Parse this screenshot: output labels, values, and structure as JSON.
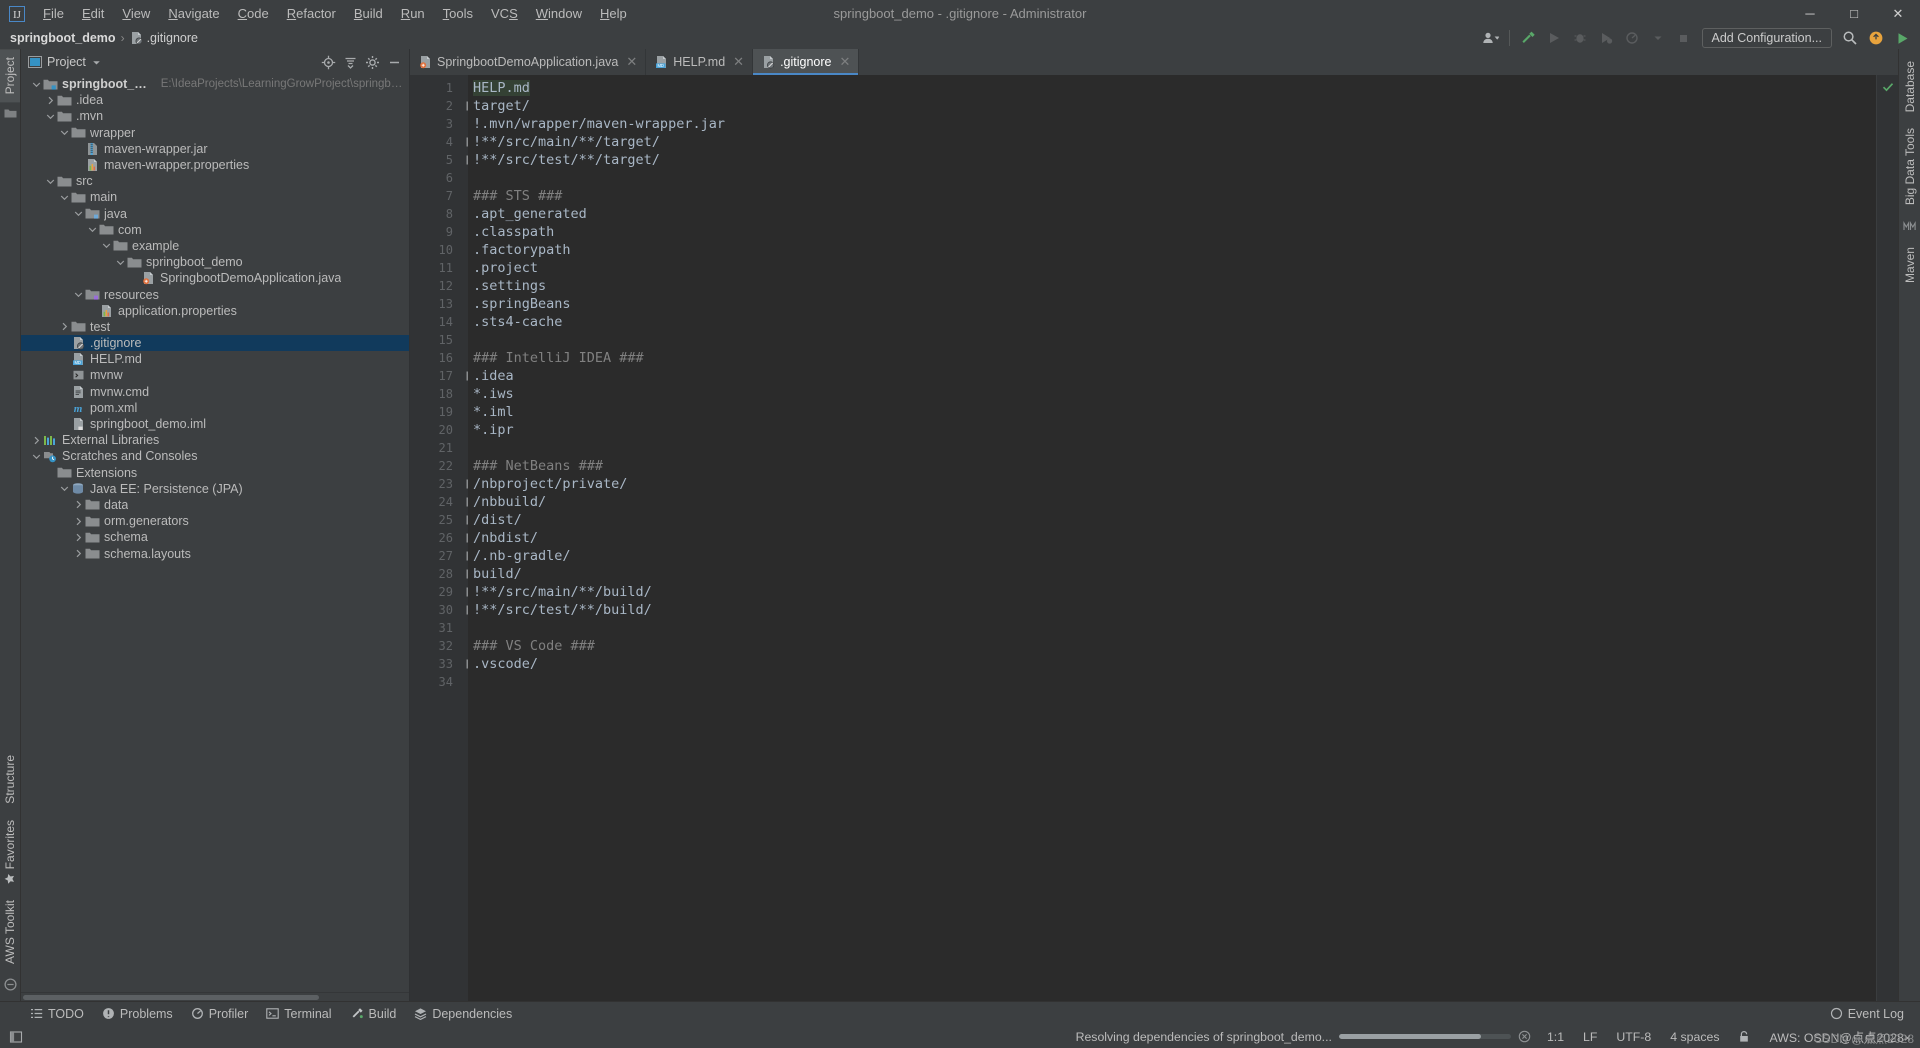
{
  "window": {
    "title": "springboot_demo - .gitignore - Administrator",
    "minimize": "─",
    "maximize": "□",
    "close": "✕"
  },
  "menubar": {
    "items": [
      {
        "label": "File",
        "mnemonic": "F"
      },
      {
        "label": "Edit",
        "mnemonic": "E"
      },
      {
        "label": "View",
        "mnemonic": "V"
      },
      {
        "label": "Navigate",
        "mnemonic": "N"
      },
      {
        "label": "Code",
        "mnemonic": "C"
      },
      {
        "label": "Refactor",
        "mnemonic": "R"
      },
      {
        "label": "Build",
        "mnemonic": "B"
      },
      {
        "label": "Run",
        "mnemonic": "R"
      },
      {
        "label": "Tools",
        "mnemonic": "T"
      },
      {
        "label": "VCS",
        "mnemonic": "S"
      },
      {
        "label": "Window",
        "mnemonic": "W"
      },
      {
        "label": "Help",
        "mnemonic": "H"
      }
    ]
  },
  "navbar": {
    "breadcrumb": [
      {
        "label": "springboot_demo",
        "bold": true
      },
      {
        "label": ".gitignore",
        "bold": false
      }
    ],
    "separator": "›",
    "add_configuration": "Add Configuration...",
    "icons": [
      "user-avatar-icon",
      "hammer-build-icon",
      "run-icon",
      "debug-icon",
      "run-coverage-icon",
      "profiler-icon",
      "stop-icon",
      "search-icon",
      "plugin-update-icon",
      "run-green-icon"
    ]
  },
  "left_rail": {
    "tabs": [
      "Project"
    ],
    "bottom_tabs": [
      "Structure",
      "Favorites",
      "AWS Toolkit"
    ]
  },
  "right_rail": {
    "tabs": [
      "Database",
      "Big Data Tools",
      "Maven"
    ]
  },
  "project_panel": {
    "title": "Project",
    "toolbar_icons": [
      "locate-target-icon",
      "collapse-all-icon",
      "settings-gear-icon",
      "hide-minus-icon"
    ],
    "tree": [
      {
        "depth": 0,
        "label": "springboot_demo",
        "path": "E:\\IdeaProjects\\LearningGrowProject\\springboot_demo",
        "arrow": "down",
        "icon": "module-folder-icon",
        "bold": true,
        "selected": false
      },
      {
        "depth": 1,
        "label": ".idea",
        "path": "",
        "arrow": "right",
        "icon": "folder-icon",
        "bold": false,
        "selected": false
      },
      {
        "depth": 1,
        "label": ".mvn",
        "path": "",
        "arrow": "down",
        "icon": "folder-icon",
        "bold": false,
        "selected": false
      },
      {
        "depth": 2,
        "label": "wrapper",
        "path": "",
        "arrow": "down",
        "icon": "folder-icon",
        "bold": false,
        "selected": false
      },
      {
        "depth": 3,
        "label": "maven-wrapper.jar",
        "path": "",
        "arrow": "none",
        "icon": "jar-file-icon",
        "bold": false,
        "selected": false
      },
      {
        "depth": 3,
        "label": "maven-wrapper.properties",
        "path": "",
        "arrow": "none",
        "icon": "properties-file-icon",
        "bold": false,
        "selected": false
      },
      {
        "depth": 1,
        "label": "src",
        "path": "",
        "arrow": "down",
        "icon": "folder-icon",
        "bold": false,
        "selected": false
      },
      {
        "depth": 2,
        "label": "main",
        "path": "",
        "arrow": "down",
        "icon": "folder-icon",
        "bold": false,
        "selected": false
      },
      {
        "depth": 3,
        "label": "java",
        "path": "",
        "arrow": "down",
        "icon": "source-folder-icon",
        "bold": false,
        "selected": false
      },
      {
        "depth": 4,
        "label": "com",
        "path": "",
        "arrow": "down",
        "icon": "package-folder-icon",
        "bold": false,
        "selected": false
      },
      {
        "depth": 5,
        "label": "example",
        "path": "",
        "arrow": "down",
        "icon": "package-folder-icon",
        "bold": false,
        "selected": false
      },
      {
        "depth": 6,
        "label": "springboot_demo",
        "path": "",
        "arrow": "down",
        "icon": "package-folder-icon",
        "bold": false,
        "selected": false
      },
      {
        "depth": 7,
        "label": "SpringbootDemoApplication.java",
        "path": "",
        "arrow": "none",
        "icon": "spring-class-icon",
        "bold": false,
        "selected": false
      },
      {
        "depth": 3,
        "label": "resources",
        "path": "",
        "arrow": "down",
        "icon": "resources-folder-icon",
        "bold": false,
        "selected": false
      },
      {
        "depth": 4,
        "label": "application.properties",
        "path": "",
        "arrow": "none",
        "icon": "properties-file-icon",
        "bold": false,
        "selected": false
      },
      {
        "depth": 2,
        "label": "test",
        "path": "",
        "arrow": "right",
        "icon": "folder-icon",
        "bold": false,
        "selected": false
      },
      {
        "depth": 2,
        "label": ".gitignore",
        "path": "",
        "arrow": "none",
        "icon": "gitignore-file-icon",
        "bold": false,
        "selected": true
      },
      {
        "depth": 2,
        "label": "HELP.md",
        "path": "",
        "arrow": "none",
        "icon": "markdown-file-icon",
        "bold": false,
        "selected": false
      },
      {
        "depth": 2,
        "label": "mvnw",
        "path": "",
        "arrow": "none",
        "icon": "shell-script-icon",
        "bold": false,
        "selected": false
      },
      {
        "depth": 2,
        "label": "mvnw.cmd",
        "path": "",
        "arrow": "none",
        "icon": "cmd-file-icon",
        "bold": false,
        "selected": false
      },
      {
        "depth": 2,
        "label": "pom.xml",
        "path": "",
        "arrow": "none",
        "icon": "maven-pom-icon",
        "bold": false,
        "selected": false
      },
      {
        "depth": 2,
        "label": "springboot_demo.iml",
        "path": "",
        "arrow": "none",
        "icon": "iml-file-icon",
        "bold": false,
        "selected": false
      },
      {
        "depth": 0,
        "label": "External Libraries",
        "path": "",
        "arrow": "right",
        "icon": "libraries-icon",
        "bold": false,
        "selected": false
      },
      {
        "depth": 0,
        "label": "Scratches and Consoles",
        "path": "",
        "arrow": "down",
        "icon": "scratches-icon",
        "bold": false,
        "selected": false
      },
      {
        "depth": 1,
        "label": "Extensions",
        "path": "",
        "arrow": "none",
        "icon": "folder-icon",
        "bold": false,
        "selected": false
      },
      {
        "depth": 2,
        "label": "Java EE: Persistence (JPA)",
        "path": "",
        "arrow": "down",
        "icon": "jpa-icon",
        "bold": false,
        "selected": false
      },
      {
        "depth": 3,
        "label": "data",
        "path": "",
        "arrow": "right",
        "icon": "folder-icon",
        "bold": false,
        "selected": false
      },
      {
        "depth": 3,
        "label": "orm.generators",
        "path": "",
        "arrow": "right",
        "icon": "folder-icon",
        "bold": false,
        "selected": false
      },
      {
        "depth": 3,
        "label": "schema",
        "path": "",
        "arrow": "right",
        "icon": "folder-icon",
        "bold": false,
        "selected": false
      },
      {
        "depth": 3,
        "label": "schema.layouts",
        "path": "",
        "arrow": "right",
        "icon": "folder-icon",
        "bold": false,
        "selected": false
      }
    ]
  },
  "editor": {
    "tabs": [
      {
        "label": "SpringbootDemoApplication.java",
        "icon": "spring-class-icon",
        "active": false,
        "close": "✕"
      },
      {
        "label": "HELP.md",
        "icon": "markdown-file-icon",
        "active": false,
        "close": "✕"
      },
      {
        "label": ".gitignore",
        "icon": "gitignore-file-icon",
        "active": true,
        "close": "✕"
      }
    ],
    "lines": [
      {
        "n": 1,
        "text": "HELP.md",
        "comment": false,
        "folder": false,
        "highlight": true
      },
      {
        "n": 2,
        "text": "target/",
        "comment": false,
        "folder": true,
        "highlight": false
      },
      {
        "n": 3,
        "text": "!.mvn/wrapper/maven-wrapper.jar",
        "comment": false,
        "folder": false,
        "highlight": false
      },
      {
        "n": 4,
        "text": "!**/src/main/**/target/",
        "comment": false,
        "folder": true,
        "highlight": false
      },
      {
        "n": 5,
        "text": "!**/src/test/**/target/",
        "comment": false,
        "folder": true,
        "highlight": false
      },
      {
        "n": 6,
        "text": "",
        "comment": false,
        "folder": false,
        "highlight": false
      },
      {
        "n": 7,
        "text": "### STS ###",
        "comment": true,
        "folder": false,
        "highlight": false
      },
      {
        "n": 8,
        "text": ".apt_generated",
        "comment": false,
        "folder": false,
        "highlight": false
      },
      {
        "n": 9,
        "text": ".classpath",
        "comment": false,
        "folder": false,
        "highlight": false
      },
      {
        "n": 10,
        "text": ".factorypath",
        "comment": false,
        "folder": false,
        "highlight": false
      },
      {
        "n": 11,
        "text": ".project",
        "comment": false,
        "folder": false,
        "highlight": false
      },
      {
        "n": 12,
        "text": ".settings",
        "comment": false,
        "folder": false,
        "highlight": false
      },
      {
        "n": 13,
        "text": ".springBeans",
        "comment": false,
        "folder": false,
        "highlight": false
      },
      {
        "n": 14,
        "text": ".sts4-cache",
        "comment": false,
        "folder": false,
        "highlight": false
      },
      {
        "n": 15,
        "text": "",
        "comment": false,
        "folder": false,
        "highlight": false
      },
      {
        "n": 16,
        "text": "### IntelliJ IDEA ###",
        "comment": true,
        "folder": false,
        "highlight": false
      },
      {
        "n": 17,
        "text": ".idea",
        "comment": false,
        "folder": true,
        "highlight": false
      },
      {
        "n": 18,
        "text": "*.iws",
        "comment": false,
        "folder": false,
        "highlight": false
      },
      {
        "n": 19,
        "text": "*.iml",
        "comment": false,
        "folder": false,
        "highlight": false
      },
      {
        "n": 20,
        "text": "*.ipr",
        "comment": false,
        "folder": false,
        "highlight": false
      },
      {
        "n": 21,
        "text": "",
        "comment": false,
        "folder": false,
        "highlight": false
      },
      {
        "n": 22,
        "text": "### NetBeans ###",
        "comment": true,
        "folder": false,
        "highlight": false
      },
      {
        "n": 23,
        "text": "/nbproject/private/",
        "comment": false,
        "folder": true,
        "highlight": false
      },
      {
        "n": 24,
        "text": "/nbbuild/",
        "comment": false,
        "folder": true,
        "highlight": false
      },
      {
        "n": 25,
        "text": "/dist/",
        "comment": false,
        "folder": true,
        "highlight": false
      },
      {
        "n": 26,
        "text": "/nbdist/",
        "comment": false,
        "folder": true,
        "highlight": false
      },
      {
        "n": 27,
        "text": "/.nb-gradle/",
        "comment": false,
        "folder": true,
        "highlight": false
      },
      {
        "n": 28,
        "text": "build/",
        "comment": false,
        "folder": true,
        "highlight": false
      },
      {
        "n": 29,
        "text": "!**/src/main/**/build/",
        "comment": false,
        "folder": true,
        "highlight": false
      },
      {
        "n": 30,
        "text": "!**/src/test/**/build/",
        "comment": false,
        "folder": true,
        "highlight": false
      },
      {
        "n": 31,
        "text": "",
        "comment": false,
        "folder": false,
        "highlight": false
      },
      {
        "n": 32,
        "text": "### VS Code ###",
        "comment": true,
        "folder": false,
        "highlight": false
      },
      {
        "n": 33,
        "text": ".vscode/",
        "comment": false,
        "folder": true,
        "highlight": false
      },
      {
        "n": 34,
        "text": "",
        "comment": false,
        "folder": false,
        "highlight": false
      }
    ]
  },
  "bottom_bar": {
    "tools": [
      {
        "label": "TODO",
        "icon": "todo-list-icon"
      },
      {
        "label": "Problems",
        "icon": "problems-warning-icon"
      },
      {
        "label": "Profiler",
        "icon": "profiler-icon"
      },
      {
        "label": "Terminal",
        "icon": "terminal-icon"
      },
      {
        "label": "Build",
        "icon": "build-hammer-icon"
      },
      {
        "label": "Dependencies",
        "icon": "dependencies-layers-icon"
      }
    ],
    "event_log": "Event Log"
  },
  "statusbar": {
    "progress_text": "Resolving dependencies of springboot_demo...",
    "caret_position": "1:1",
    "line_separator": "LF",
    "encoding": "UTF-8",
    "indent": "4 spaces",
    "aws": "AWS: OSDN@点点2028×",
    "watermark": "CSDN @点点2028"
  },
  "colors": {
    "accent": "#4a88c7",
    "selection": "#113a5c",
    "panel_bg": "#3c3f41",
    "editor_bg": "#2b2b2b",
    "gutter_bg": "#313335",
    "text": "#bbbbbb",
    "code_text": "#a9b7c6",
    "comment": "#808080",
    "ok_green": "#59a869"
  }
}
